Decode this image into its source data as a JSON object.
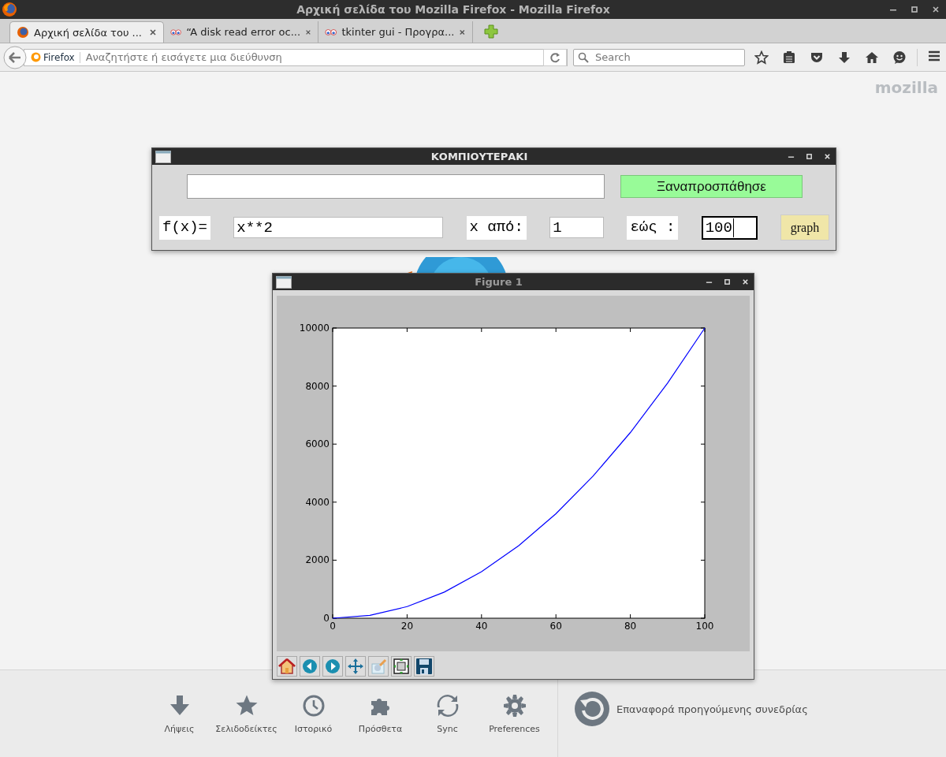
{
  "window": {
    "title": "Αρχική σελίδα του Mozilla Firefox - Mozilla Firefox"
  },
  "tabs": [
    {
      "label": "Αρχική σελίδα του ...",
      "selected": true,
      "kind": "firefox"
    },
    {
      "label": "“A disk read error oc...",
      "selected": false,
      "kind": "forum"
    },
    {
      "label": "tkinter gui - Προγρα...",
      "selected": false,
      "kind": "forum"
    }
  ],
  "address_bar": {
    "identity": "Firefox",
    "placeholder": "Αναζητήστε ή εισάγετε μια διεύθυνση"
  },
  "search": {
    "placeholder": "Search"
  },
  "brand": "mozilla",
  "app_window": {
    "title": "ΚΟΜΠΙΟΥΤΕΡΑΚΙ",
    "retry_button": "Ξαναπροσπάθησε",
    "row": [
      {
        "kind": "label",
        "text": "f(x)="
      },
      {
        "kind": "input",
        "value": "x**2",
        "focused": false
      },
      {
        "kind": "label",
        "text": "x από:"
      },
      {
        "kind": "input",
        "value": "1",
        "focused": false
      },
      {
        "kind": "label",
        "text": "εώς :"
      },
      {
        "kind": "input",
        "value": "100",
        "focused": true
      },
      {
        "kind": "button",
        "text": "graph"
      }
    ]
  },
  "figure_window": {
    "title": "Figure 1",
    "chart_data": {
      "type": "line",
      "x": [
        0,
        10,
        20,
        30,
        40,
        50,
        60,
        70,
        80,
        90,
        100
      ],
      "series": [
        {
          "color": "#0000ff",
          "values": [
            0,
            100,
            400,
            900,
            1600,
            2500,
            3600,
            4900,
            6400,
            8100,
            10000
          ]
        }
      ],
      "xlim": [
        0,
        100
      ],
      "ylim": [
        0,
        10000
      ],
      "xticks": [
        0,
        20,
        40,
        60,
        80,
        100
      ],
      "yticks": [
        0,
        2000,
        4000,
        6000,
        8000,
        10000
      ]
    }
  },
  "launcher": [
    {
      "kind": "downloads",
      "label": "Λήψεις"
    },
    {
      "kind": "bookmarks",
      "label": "Σελιδοδείκτες"
    },
    {
      "kind": "history",
      "label": "Ιστορικό"
    },
    {
      "kind": "addons",
      "label": "Πρόσθετα"
    },
    {
      "kind": "sync",
      "label": "Sync"
    },
    {
      "kind": "preferences",
      "label": "Preferences"
    }
  ],
  "restore": {
    "label": "Επαναφορά προηγούμενης συνεδρίας"
  }
}
